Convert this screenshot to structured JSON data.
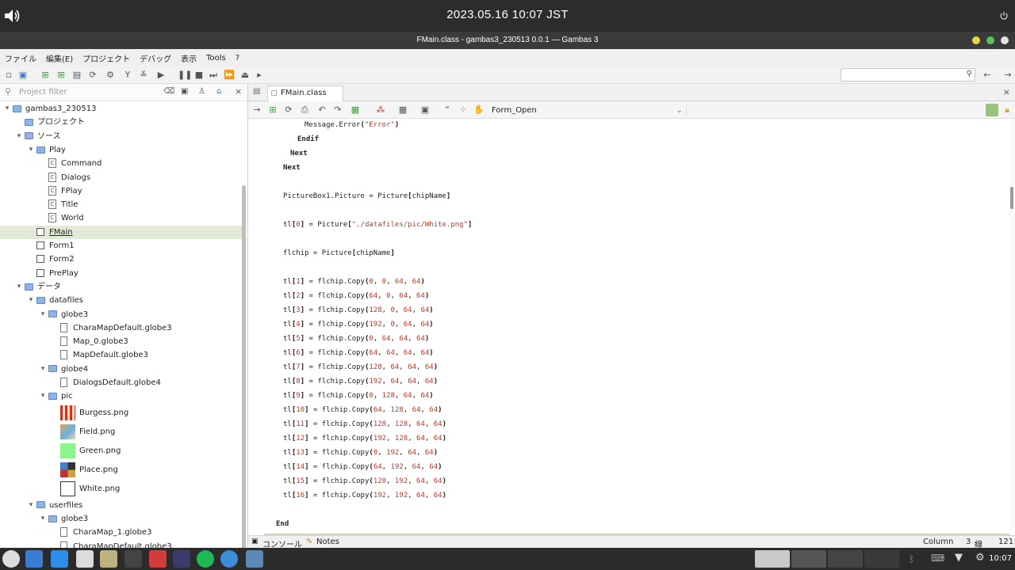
{
  "system": {
    "clock": "2023.05.16 10:07 JST",
    "tray_time": "10:07"
  },
  "window": {
    "title": "FMain.class - gambas3_230513 0.0.1 — Gambas 3"
  },
  "menu": [
    "ファイル",
    "編集(E)",
    "プロジェクト",
    "デバッグ",
    "表示",
    "Tools",
    "?"
  ],
  "project_filter": {
    "placeholder": "Project filter"
  },
  "tree": [
    {
      "label": "gambas3_230513",
      "indent": 0,
      "icon": "project",
      "arrow": "▾"
    },
    {
      "label": "プロジェクト",
      "indent": 1,
      "icon": "folder",
      "arrow": ""
    },
    {
      "label": "ソース",
      "indent": 1,
      "icon": "folder",
      "arrow": "▾"
    },
    {
      "label": "Play",
      "indent": 2,
      "icon": "folder",
      "arrow": "▾"
    },
    {
      "label": "Command",
      "indent": 3,
      "icon": "class",
      "arrow": ""
    },
    {
      "label": "Dialogs",
      "indent": 3,
      "icon": "class",
      "arrow": ""
    },
    {
      "label": "FPlay",
      "indent": 3,
      "icon": "class",
      "arrow": ""
    },
    {
      "label": "Title",
      "indent": 3,
      "icon": "class",
      "arrow": ""
    },
    {
      "label": "World",
      "indent": 3,
      "icon": "class",
      "arrow": ""
    },
    {
      "label": "FMain",
      "indent": 2,
      "icon": "form",
      "arrow": "",
      "selected": true
    },
    {
      "label": "Form1",
      "indent": 2,
      "icon": "form",
      "arrow": ""
    },
    {
      "label": "Form2",
      "indent": 2,
      "icon": "form",
      "arrow": ""
    },
    {
      "label": "PrePlay",
      "indent": 2,
      "icon": "form",
      "arrow": ""
    },
    {
      "label": "データ",
      "indent": 1,
      "icon": "folder",
      "arrow": "▾"
    },
    {
      "label": "datafiles",
      "indent": 2,
      "icon": "folder",
      "arrow": "▾"
    },
    {
      "label": "globe3",
      "indent": 3,
      "icon": "folder",
      "arrow": "▾"
    },
    {
      "label": "CharaMapDefault.globe3",
      "indent": 4,
      "icon": "doc",
      "arrow": ""
    },
    {
      "label": "Map_0.globe3",
      "indent": 4,
      "icon": "doc",
      "arrow": ""
    },
    {
      "label": "MapDefault.globe3",
      "indent": 4,
      "icon": "doc",
      "arrow": ""
    },
    {
      "label": "globe4",
      "indent": 3,
      "icon": "folder",
      "arrow": "▾"
    },
    {
      "label": "DialogsDefault.globe4",
      "indent": 4,
      "icon": "doc",
      "arrow": ""
    },
    {
      "label": "pic",
      "indent": 3,
      "icon": "folder",
      "arrow": "▾"
    },
    {
      "label": "Burgess.png",
      "indent": 4,
      "icon": "img-burgess",
      "arrow": "",
      "tall": true
    },
    {
      "label": "Field.png",
      "indent": 4,
      "icon": "img-field",
      "arrow": "",
      "tall": true
    },
    {
      "label": "Green.png",
      "indent": 4,
      "icon": "img-green",
      "arrow": "",
      "tall": true
    },
    {
      "label": "Place.png",
      "indent": 4,
      "icon": "img-place",
      "arrow": "",
      "tall": true
    },
    {
      "label": "White.png",
      "indent": 4,
      "icon": "img-white",
      "arrow": "",
      "tall": true
    },
    {
      "label": "userfiles",
      "indent": 2,
      "icon": "folder",
      "arrow": "▾"
    },
    {
      "label": "globe3",
      "indent": 3,
      "icon": "folder",
      "arrow": "▾"
    },
    {
      "label": "CharaMap_1.globe3",
      "indent": 4,
      "icon": "doc",
      "arrow": ""
    },
    {
      "label": "CharaMapDefault.globe3",
      "indent": 4,
      "icon": "doc",
      "arrow": ""
    }
  ],
  "editor": {
    "tab_label": "FMain.class",
    "procedure": "Form_Open",
    "lines": [
      {
        "text": "Message.Error(\"Error\")",
        "indent": 3,
        "kind": "error"
      },
      {
        "text": "Endif",
        "indent": 2,
        "kind": "kw"
      },
      {
        "text": "Next",
        "indent": 1,
        "kind": "kw"
      },
      {
        "text": "Next",
        "indent": 0,
        "kind": "kw"
      },
      {
        "text": "",
        "indent": 0,
        "kind": "blank"
      },
      {
        "text": "PictureBox1.Picture = Picture[chipName]",
        "indent": 0,
        "kind": "plain"
      },
      {
        "text": "",
        "indent": 0,
        "kind": "blank"
      },
      {
        "text": "tl[0] = Picture[\"./datafiles/pic/White.png\"]",
        "indent": 0,
        "kind": "plain"
      },
      {
        "text": "",
        "indent": 0,
        "kind": "blank"
      },
      {
        "text": "flchip = Picture[chipName]",
        "indent": 0,
        "kind": "plain"
      },
      {
        "text": "",
        "indent": 0,
        "kind": "blank"
      },
      {
        "text": "tl[1] = flchip.Copy(0, 0, 64, 64)",
        "indent": 0,
        "kind": "copy"
      },
      {
        "text": "tl[2] = flchip.Copy(64, 0, 64, 64)",
        "indent": 0,
        "kind": "copy"
      },
      {
        "text": "tl[3] = flchip.Copy(128, 0, 64, 64)",
        "indent": 0,
        "kind": "copy"
      },
      {
        "text": "tl[4] = flchip.Copy(192, 0, 64, 64)",
        "indent": 0,
        "kind": "copy"
      },
      {
        "text": "tl[5] = flchip.Copy(0, 64, 64, 64)",
        "indent": 0,
        "kind": "copy"
      },
      {
        "text": "tl[6] = flchip.Copy(64, 64, 64, 64)",
        "indent": 0,
        "kind": "copy"
      },
      {
        "text": "tl[7] = flchip.Copy(128, 64, 64, 64)",
        "indent": 0,
        "kind": "copy"
      },
      {
        "text": "tl[8] = flchip.Copy(192, 64, 64, 64)",
        "indent": 0,
        "kind": "copy"
      },
      {
        "text": "tl[9] = flchip.Copy(0, 128, 64, 64)",
        "indent": 0,
        "kind": "copy"
      },
      {
        "text": "tl[10] = flchip.Copy(64, 128, 64, 64)",
        "indent": 0,
        "kind": "copy"
      },
      {
        "text": "tl[11] = flchip.Copy(128, 128, 64, 64)",
        "indent": 0,
        "kind": "copy"
      },
      {
        "text": "tl[12] = flchip.Copy(192, 128, 64, 64)",
        "indent": 0,
        "kind": "copy"
      },
      {
        "text": "tl[13] = flchip.Copy(0, 192, 64, 64)",
        "indent": 0,
        "kind": "copy"
      },
      {
        "text": "tl[14] = flchip.Copy(64, 192, 64, 64)",
        "indent": 0,
        "kind": "copy"
      },
      {
        "text": "tl[15] = flchip.Copy(128, 192, 64, 64)",
        "indent": 0,
        "kind": "copy"
      },
      {
        "text": "tl[16] = flchip.Copy(192, 192, 64, 64)",
        "indent": 0,
        "kind": "copy"
      },
      {
        "text": "",
        "indent": 0,
        "kind": "blank"
      },
      {
        "text": "End",
        "indent": -1,
        "kind": "kw"
      }
    ]
  },
  "status": {
    "console": "コンソール",
    "notes": "Notes",
    "column_label": "Column",
    "column_value": "3",
    "line_label": "線",
    "line_value": "121"
  },
  "colors": {
    "selection": "#e3ebd8",
    "number": "#c0392b",
    "folder": "#8db4e2"
  }
}
